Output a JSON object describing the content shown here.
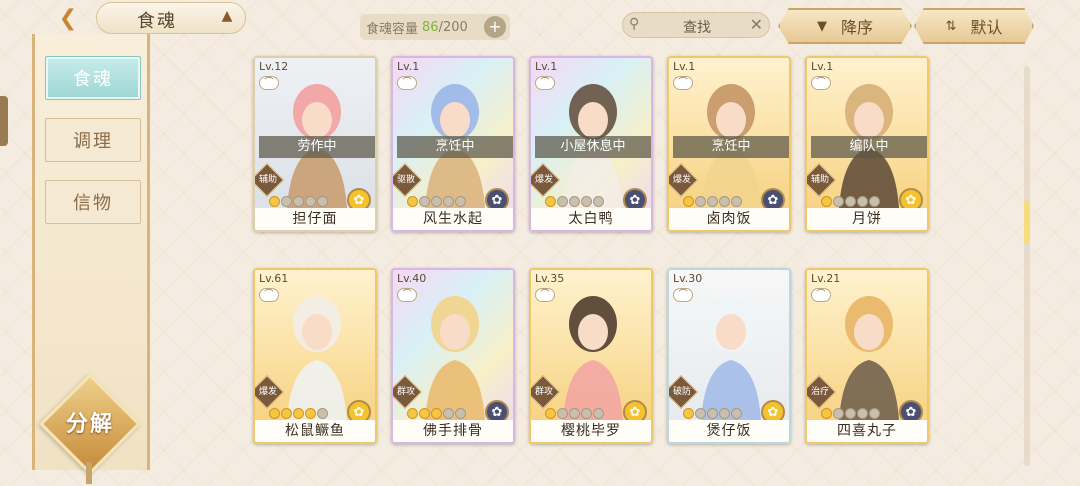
{
  "header": {
    "tab_title": "食魂",
    "capacity_label": "食魂容量",
    "capacity_current": "86",
    "capacity_max": "/200",
    "search_label": "查找",
    "sort_order_label": "降序",
    "sort_key_label": "默认"
  },
  "sidebar": {
    "tabs": [
      {
        "label": "食魂",
        "active": true
      },
      {
        "label": "调理",
        "active": false
      },
      {
        "label": "信物",
        "active": false
      }
    ],
    "decompose_label": "分解"
  },
  "cards": [
    {
      "level": "Lv.12",
      "status": "劳作中",
      "role": "辅助",
      "stars": 1,
      "name": "担仔面",
      "rarity": "r",
      "element_color": "#f5c22f"
    },
    {
      "level": "Lv.1",
      "status": "烹饪中",
      "role": "驱散",
      "stars": 1,
      "name": "风生水起",
      "rarity": "ssr",
      "element_color": "#4a4f73"
    },
    {
      "level": "Lv.1",
      "status": "小屋休息中",
      "role": "爆发",
      "stars": 1,
      "name": "太白鸭",
      "rarity": "ssr",
      "element_color": "#4a4f73"
    },
    {
      "level": "Lv.1",
      "status": "烹饪中",
      "role": "爆发",
      "stars": 1,
      "name": "卤肉饭",
      "rarity": "ur",
      "element_color": "#4a4f73"
    },
    {
      "level": "Lv.1",
      "status": "编队中",
      "role": "辅助",
      "stars": 1,
      "name": "月饼",
      "rarity": "ur",
      "element_color": "#f5c22f"
    },
    {
      "level": "Lv.61",
      "status": "",
      "role": "爆发",
      "stars": 4,
      "name": "松鼠鳜鱼",
      "rarity": "ur",
      "element_color": "#f5c22f"
    },
    {
      "level": "Lv.40",
      "status": "",
      "role": "群攻",
      "stars": 3,
      "name": "佛手排骨",
      "rarity": "ssr",
      "element_color": "#4a4f73"
    },
    {
      "level": "Lv.35",
      "status": "",
      "role": "群攻",
      "stars": 1,
      "name": "樱桃毕罗",
      "rarity": "ur",
      "element_color": "#f5c22f"
    },
    {
      "level": "Lv.30",
      "status": "",
      "role": "破防",
      "stars": 1,
      "name": "煲仔饭",
      "rarity": "sr",
      "element_color": "#f5c22f"
    },
    {
      "level": "Lv.21",
      "status": "",
      "role": "治疗",
      "stars": 1,
      "name": "四喜丸子",
      "rarity": "ur",
      "element_color": "#4a4f73"
    }
  ]
}
